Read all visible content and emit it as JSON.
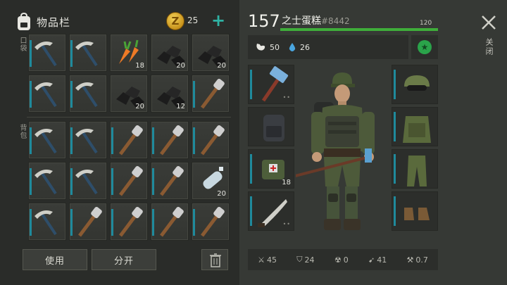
{
  "inventory": {
    "title": "物品栏",
    "pocket_label": "口袋",
    "backpack_label": "背包",
    "coins": "25",
    "add_icon": "plus-icon",
    "use_label": "使用",
    "split_label": "分开",
    "pocket_slots": [
      {
        "item": "pickaxe",
        "qty": ""
      },
      {
        "item": "pickaxe",
        "qty": ""
      },
      {
        "item": "carrot",
        "qty": "18"
      },
      {
        "item": "coal",
        "qty": "20"
      },
      {
        "item": "coal",
        "qty": "20"
      },
      {
        "item": "pickaxe",
        "qty": ""
      },
      {
        "item": "pickaxe",
        "qty": ""
      },
      {
        "item": "coal",
        "qty": "20"
      },
      {
        "item": "coal",
        "qty": "12"
      },
      {
        "item": "torch",
        "qty": ""
      }
    ],
    "backpack_slots": [
      {
        "item": "pickaxe",
        "qty": ""
      },
      {
        "item": "pickaxe",
        "qty": ""
      },
      {
        "item": "torch",
        "qty": ""
      },
      {
        "item": "torch",
        "qty": ""
      },
      {
        "item": "torch",
        "qty": ""
      },
      {
        "item": "pickaxe",
        "qty": ""
      },
      {
        "item": "pickaxe",
        "qty": ""
      },
      {
        "item": "torch",
        "qty": ""
      },
      {
        "item": "torch",
        "qty": ""
      },
      {
        "item": "water-bottle",
        "qty": "20"
      },
      {
        "item": "pickaxe",
        "qty": ""
      },
      {
        "item": "torch",
        "qty": ""
      },
      {
        "item": "torch",
        "qty": ""
      },
      {
        "item": "torch",
        "qty": ""
      },
      {
        "item": "torch",
        "qty": ""
      }
    ]
  },
  "player": {
    "level": "157",
    "name": "之士蛋糕",
    "id": "#8442",
    "xp_value": "120",
    "xp_fraction": 1.0,
    "food": "50",
    "water": "26"
  },
  "equipment": {
    "left": [
      {
        "item": "sledgehammer",
        "qty": "",
        "dots": "••"
      },
      {
        "item": "backpack",
        "qty": "",
        "dots": ""
      },
      {
        "item": "medkit-bag",
        "qty": "18",
        "dots": ""
      },
      {
        "item": "machete",
        "qty": "",
        "dots": "••"
      }
    ],
    "right": [
      {
        "item": "cap-goggles"
      },
      {
        "item": "camo-vest"
      },
      {
        "item": "camo-pants"
      },
      {
        "item": "boots"
      }
    ]
  },
  "combat_stats": {
    "damage": "45",
    "armor": "24",
    "radiation": "0",
    "speed": "41",
    "attack_speed": "0.7"
  },
  "close_label": "关闭",
  "colors": {
    "accent_teal": "#1f8a9c",
    "xp_green": "#3fae3a",
    "plus_teal": "#2fb3a4"
  }
}
